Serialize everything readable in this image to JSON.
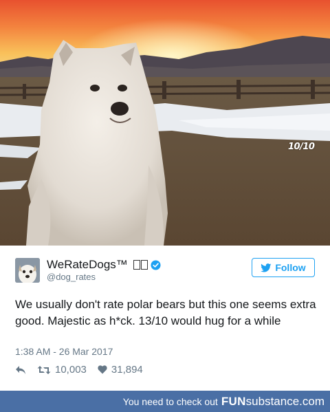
{
  "photo": {
    "subject": "white fluffy dog sitting in a snowy field at sunset",
    "watermark": "10/10"
  },
  "tweet": {
    "display_name": "WeRateDogs™",
    "handle": "@dog_rates",
    "follow_label": "Follow",
    "text": "We usually don't rate polar bears but this one seems extra good. Majestic as h*ck. 13/10 would hug for a while",
    "timestamp": "1:38 AM - 26 Mar 2017",
    "retweets": "10,003",
    "likes": "31,894"
  },
  "footer": {
    "lead_text": "You need to check out",
    "brand_fun": "FUN",
    "brand_rest": "substance",
    "brand_tld": ".com"
  },
  "colors": {
    "twitter_blue": "#1da1f2",
    "footer_bg": "#4a6fa5",
    "muted_text": "#657786"
  },
  "icons": [
    "reply-icon",
    "retweet-icon",
    "heart-icon",
    "twitter-bird-icon",
    "verified-badge-icon"
  ]
}
